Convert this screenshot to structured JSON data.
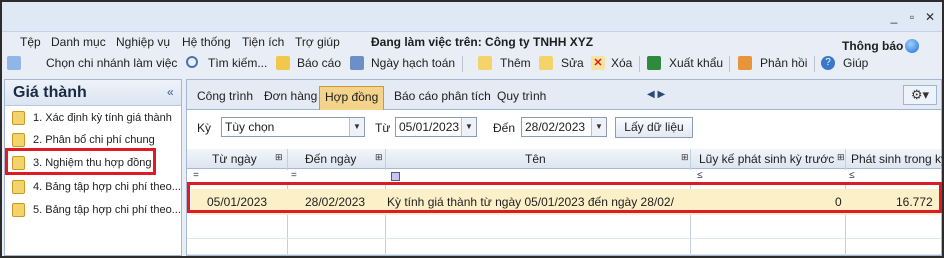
{
  "menu": {
    "items": [
      "Tệp",
      "Danh mục",
      "Nghiệp vụ",
      "Hệ thống",
      "Tiện ích",
      "Trợ giúp"
    ],
    "company": "Đang làm việc trên: Công ty TNHH XYZ",
    "notifications": "Thông báo"
  },
  "toolbar": {
    "branch": "Chọn chi nhánh làm việc",
    "search": "Tìm kiếm...",
    "report": "Báo cáo",
    "posting_date": "Ngày hạch toán",
    "add": "Thêm",
    "edit": "Sửa",
    "delete": "Xóa",
    "export": "Xuất khẩu",
    "feedback": "Phản hồi",
    "help": "Giúp"
  },
  "sidebar": {
    "title": "Giá thành",
    "items": [
      {
        "label": "1. Xác định kỳ tính giá thành"
      },
      {
        "label": "2. Phân bổ chi phí chung"
      },
      {
        "label": "3. Nghiệm thu hợp đồng"
      },
      {
        "label": "4. Bảng tập hợp chi phí theo..."
      },
      {
        "label": "5. Bảng tập hợp chi phí theo..."
      }
    ]
  },
  "tabs": [
    "Công trình",
    "Đơn hàng",
    "Hợp đồng",
    "Báo cáo phân tích",
    "Quy trình"
  ],
  "active_tab": "Hợp đồng",
  "filter": {
    "period_label": "Kỳ",
    "period_value": "Tùy chọn",
    "from_label": "Từ",
    "from_value": "05/01/2023",
    "to_label": "Đến",
    "to_value": "28/02/2023",
    "load_button": "Lấy dữ liệu"
  },
  "grid": {
    "columns": [
      "Từ ngày",
      "Đến ngày",
      "Tên",
      "Lũy kế phát sinh kỳ trước",
      "Phát sinh trong kỳ"
    ],
    "filter_ops": [
      "=",
      "=",
      "",
      "≤",
      "≤"
    ],
    "rows": [
      {
        "from": "05/01/2023",
        "to": "28/02/2023",
        "name": "Kỳ tính giá thành từ ngày 05/01/2023 đến ngày 28/02/",
        "prev_accum": "0",
        "current": "16.772"
      }
    ]
  },
  "colors": {
    "highlight_border": "#e01a22",
    "active_tab": "#f4d38a",
    "selected_row": "#fbf0c8"
  }
}
